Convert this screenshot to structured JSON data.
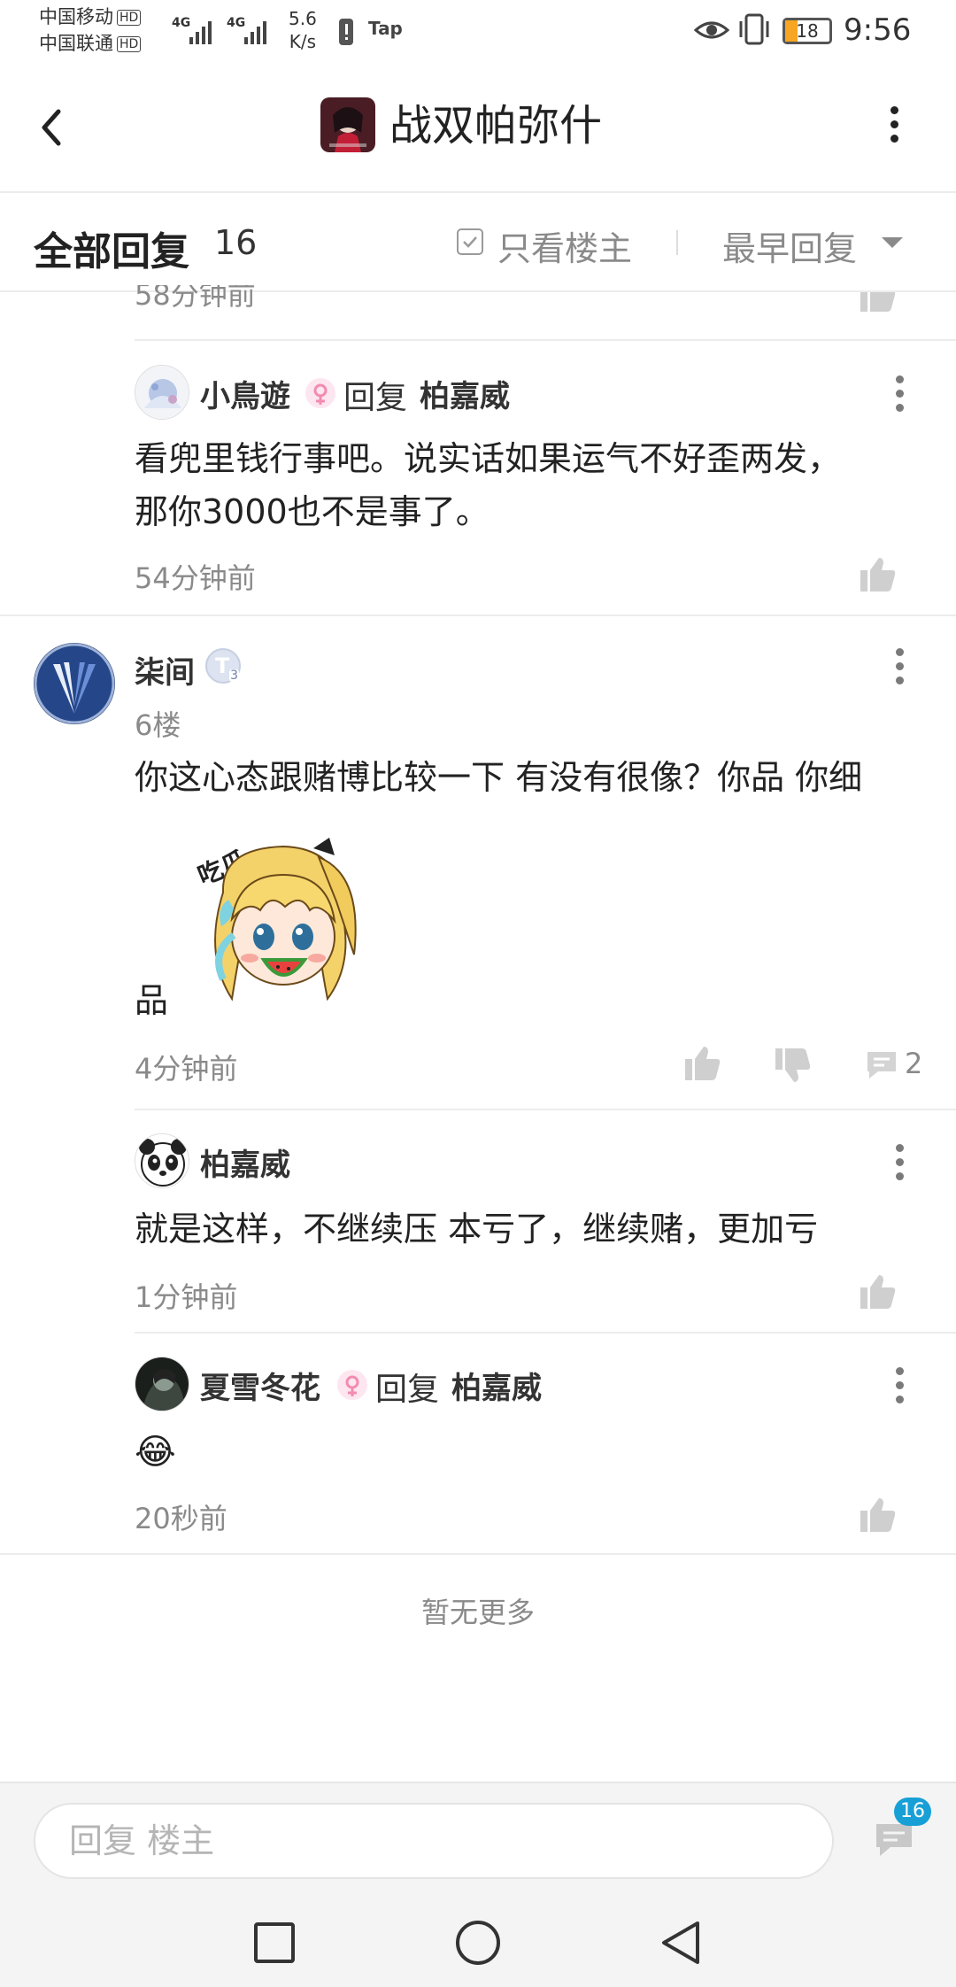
{
  "status_bar": {
    "carrier1": "中国移动",
    "carrier2": "中国联通",
    "hd": "HD",
    "network_speed_value": "5.6",
    "network_speed_unit": "K/s",
    "app_indicator": "Tap",
    "battery": "18",
    "time": "9:56",
    "net1": "4G",
    "net2": "4G"
  },
  "header": {
    "title": "战双帕弥什",
    "back_icon": "chevron-left-icon",
    "more_icon": "more-vertical-icon"
  },
  "replies_header": {
    "label": "全部回复",
    "count": "16",
    "only_op_label": "只看楼主",
    "sort_label": "最早回复"
  },
  "partial_reply": {
    "time": "58分钟前"
  },
  "comments": [
    {
      "author": "小鳥遊",
      "reply_word": "回复",
      "reply_to": "柏嘉威",
      "text_line1": "看兜里钱行事吧。说实话如果运气不好歪两发，",
      "text_line2": "那你3000也不是事了。",
      "time": "54分钟前"
    }
  ],
  "floor": {
    "author": "柒间",
    "level_badge": "T",
    "level_num": "3",
    "floor_label": "6楼",
    "text_line1": "你这心态跟赌博比较一下 有没有很像？你品 你细",
    "text_tail": "品",
    "sticker_text": "吃瓜…",
    "time": "4分钟前",
    "comment_count": "2",
    "replies": [
      {
        "author": "柏嘉威",
        "text": "就是这样，不继续压 本亏了，继续赌，更加亏",
        "time": "1分钟前"
      },
      {
        "author": "夏雪冬花",
        "reply_word": "回复",
        "reply_to": "柏嘉威",
        "text": "😂",
        "time": "20秒前"
      }
    ]
  },
  "footer": {
    "no_more": "暂无更多"
  },
  "reply_bar": {
    "placeholder": "回复  楼主",
    "badge_count": "16"
  },
  "colors": {
    "text_primary": "#222222",
    "text_secondary": "#8a8a8a",
    "badge_blue": "#18a0d6",
    "gender_pink": "#f28cb1",
    "divider": "#ececec"
  }
}
